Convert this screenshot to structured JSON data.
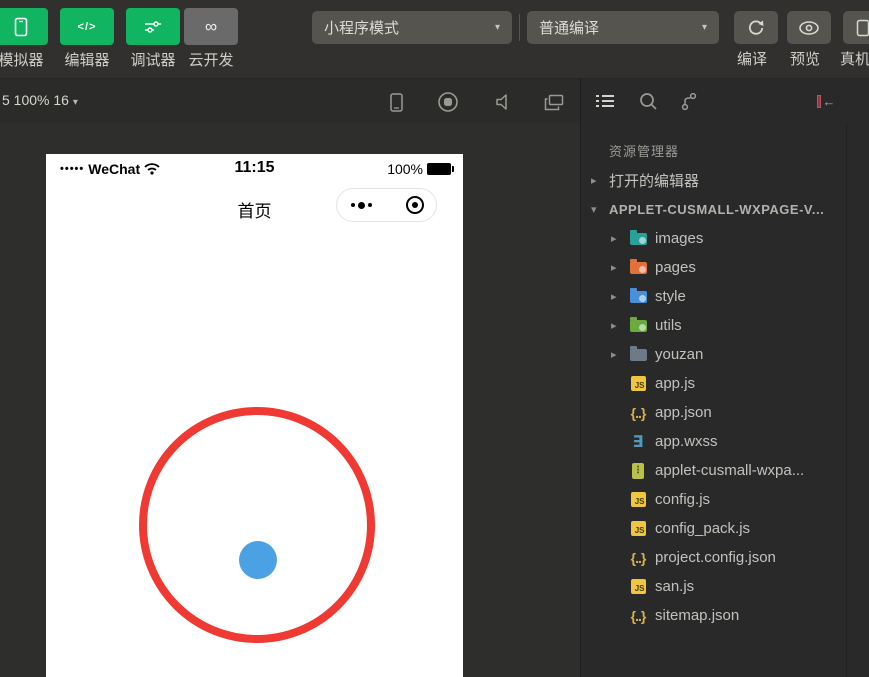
{
  "toolbar": {
    "buttons": [
      {
        "label": "模拟器",
        "icon": "phone-icon"
      },
      {
        "label": "编辑器",
        "icon": "code-icon"
      },
      {
        "label": "调试器",
        "icon": "tune-icon"
      },
      {
        "label": "云开发",
        "icon": "cloud-icon"
      }
    ],
    "mode_dropdown": "小程序模式",
    "compile_dropdown": "普通编译",
    "compile_label": "编译",
    "preview_label": "预览",
    "remote_debug_label": "真机",
    "accent_green": "#10b461",
    "cloud_gray": "#6a6a6a"
  },
  "simulator": {
    "device_info": "5 100% 16",
    "status_bar": {
      "signal_dots": "•••••",
      "carrier": "WeChat",
      "time": "11:15",
      "battery": "100%"
    },
    "nav_title": "首页",
    "shapes": {
      "ring_color": "#ee3a33",
      "dot_color": "#4aa2e5"
    }
  },
  "explorer": {
    "title": "资源管理器",
    "open_editors_label": "打开的编辑器",
    "root_label": "APPLET-CUSMALL-WXPAGE-V...",
    "items": [
      {
        "label": "images",
        "icon": "folder-images",
        "chevron": true
      },
      {
        "label": "pages",
        "icon": "folder-pages",
        "chevron": true
      },
      {
        "label": "style",
        "icon": "folder-style",
        "chevron": true
      },
      {
        "label": "utils",
        "icon": "folder-utils",
        "chevron": true
      },
      {
        "label": "youzan",
        "icon": "folder-plain",
        "chevron": true
      },
      {
        "label": "app.js",
        "icon": "js"
      },
      {
        "label": "app.json",
        "icon": "json"
      },
      {
        "label": "app.wxss",
        "icon": "wxss"
      },
      {
        "label": "applet-cusmall-wxpa...",
        "icon": "archive"
      },
      {
        "label": "config.js",
        "icon": "js"
      },
      {
        "label": "config_pack.js",
        "icon": "js"
      },
      {
        "label": "project.config.json",
        "icon": "json"
      },
      {
        "label": "san.js",
        "icon": "js"
      },
      {
        "label": "sitemap.json",
        "icon": "json"
      }
    ]
  }
}
